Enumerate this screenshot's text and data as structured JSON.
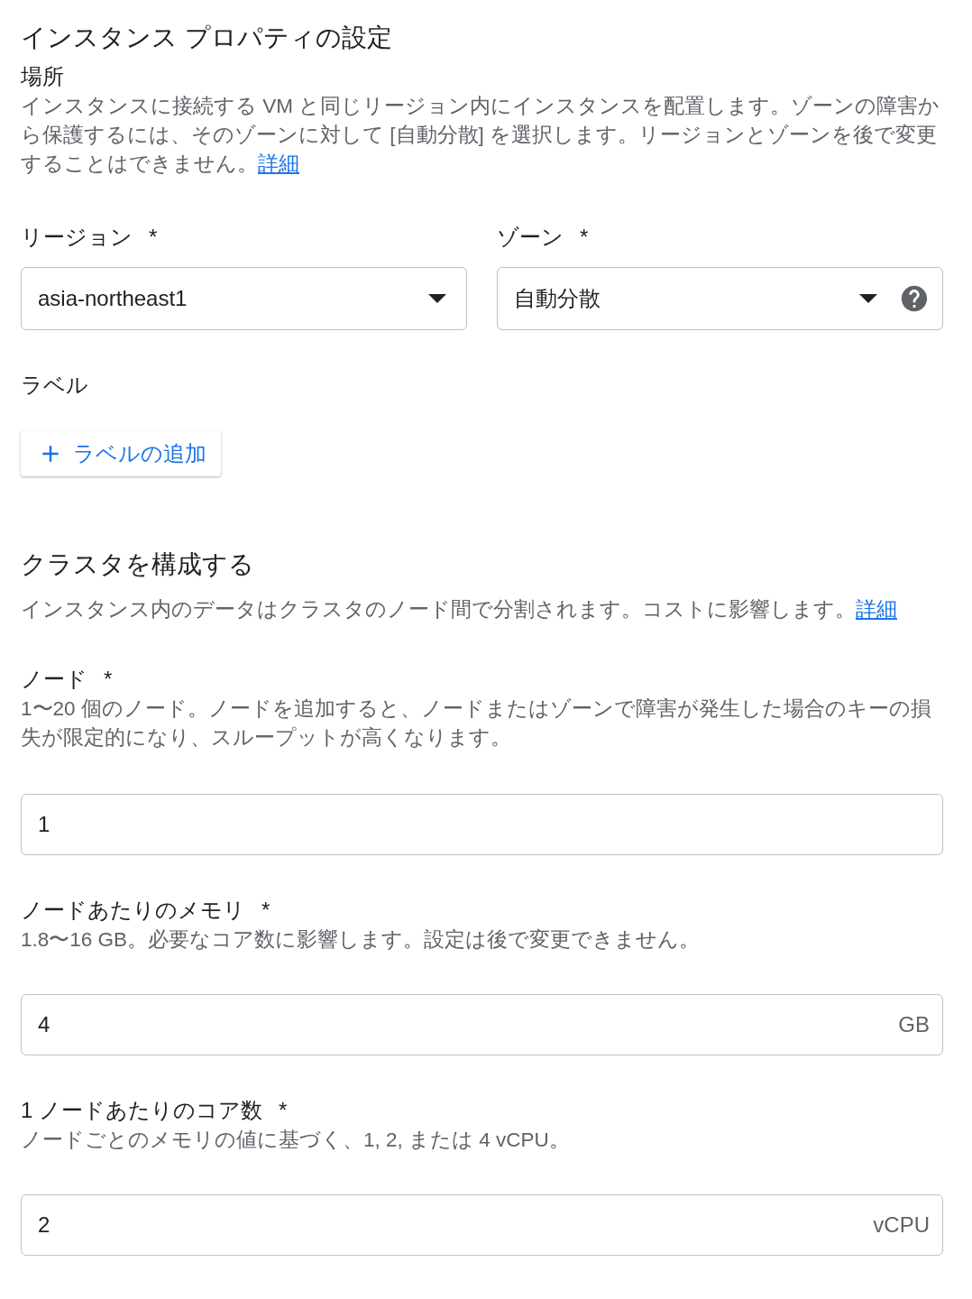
{
  "section": {
    "title": "インスタンス プロパティの設定"
  },
  "location": {
    "label": "場所",
    "description": "インスタンスに接続する VM と同じリージョン内にインスタンスを配置します。ゾーンの障害から保護するには、そのゾーンに対して [自動分散] を選択します。リージョンとゾーンを後で変更することはできません。",
    "link": "詳細"
  },
  "selects": [
    {
      "label": "リージョン",
      "mark": "*",
      "value": "asia-northeast1",
      "help_icon": false
    },
    {
      "label": "ゾーン",
      "mark": "*",
      "value": "自動分散",
      "help_icon": true
    }
  ],
  "labels": {
    "label": "ラベル",
    "add_button": "ラベルの追加"
  },
  "cluster": {
    "title": "クラスタを構成する",
    "description": "インスタンス内のデータはクラスタのノード間で分割されます。コストに影響します。",
    "link": "詳細"
  },
  "fields": [
    {
      "label": "ノード",
      "mark": "*",
      "help": "1〜20 個のノード。ノードを追加すると、ノードまたはゾーンで障害が発生した場合のキーの損失が限定的になり、スループットが高くなります。",
      "value": "1"
    },
    {
      "label": "ノードあたりのメモリ",
      "mark": "*",
      "help": "1.8〜16 GB。必要なコア数に影響します。設定は後で変更できません。",
      "value": "4",
      "suffix": "GB"
    },
    {
      "label": "1 ノードあたりのコア数",
      "mark": "*",
      "help": "ノードごとのメモリの値に基づく、1, 2, または 4 vCPU。",
      "value": "2",
      "suffix": "vCPU"
    }
  ]
}
